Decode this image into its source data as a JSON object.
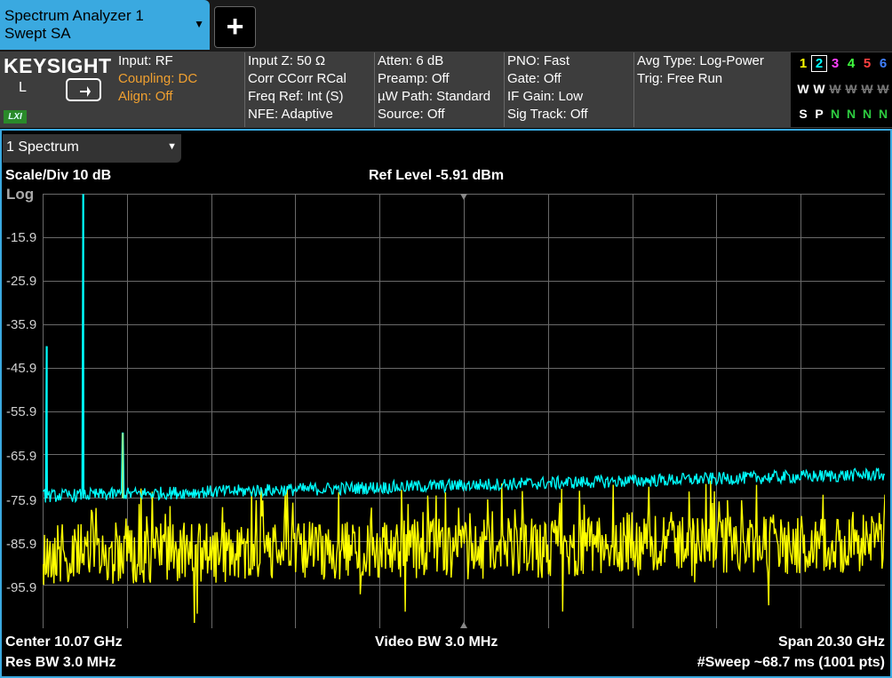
{
  "tab": {
    "title_line1": "Spectrum Analyzer 1",
    "title_line2": "Swept SA",
    "caret": "▼",
    "add_label": "+"
  },
  "brand": {
    "logo": "KEYSIGHT",
    "mode_letter": "L",
    "lxi": "LXI"
  },
  "settings": {
    "col1": [
      "Input: RF",
      "Coupling: DC",
      "Align: Off"
    ],
    "col2": [
      "Input Z: 50 Ω",
      "Corr CCorr RCal",
      "Freq Ref: Int (S)",
      "NFE: Adaptive"
    ],
    "col3": [
      "Atten: 6 dB",
      "Preamp: Off",
      "µW Path: Standard",
      "Source: Off"
    ],
    "col4": [
      "PNO: Fast",
      "Gate: Off",
      "IF Gain: Low",
      "Sig Track: Off"
    ],
    "col5": [
      "Avg Type: Log-Power",
      "Trig: Free Run"
    ]
  },
  "traces": {
    "numbers": [
      "1",
      "2",
      "3",
      "4",
      "5",
      "6"
    ],
    "number_colors": [
      "#ffff00",
      "#00ffff",
      "#ff40ff",
      "#40ff40",
      "#ff4040",
      "#4080ff"
    ],
    "modes": [
      "W",
      "W",
      "W",
      "W",
      "W",
      "W"
    ],
    "detectors": [
      "S",
      "P",
      "N",
      "N",
      "N",
      "N"
    ]
  },
  "window": {
    "label": "1 Spectrum",
    "caret": "▼"
  },
  "graph": {
    "scale": "Scale/Div 10 dB",
    "ref_level": "Ref Level -5.91 dBm",
    "log": "Log",
    "y_ticks": [
      "-15.9",
      "-25.9",
      "-35.9",
      "-45.9",
      "-55.9",
      "-65.9",
      "-75.9",
      "-85.9",
      "-95.9"
    ],
    "center": "Center 10.07 GHz",
    "res_bw": "Res BW 3.0 MHz",
    "video_bw": "Video BW 3.0 MHz",
    "span": "Span 20.30 GHz",
    "sweep": "#Sweep ~68.7 ms (1001 pts)"
  },
  "chart_data": {
    "type": "line",
    "ylim": [
      -105.91,
      -5.91
    ],
    "x_range_ghz": [
      -0.08,
      20.22
    ],
    "grid": true,
    "series": [
      {
        "color": "#ffff00",
        "floor_dbm": -82,
        "noise_span_db": 14,
        "spurs": []
      },
      {
        "color": "#00ffff",
        "floor_dbm": -77,
        "noise_span_db": 3,
        "slope_db": 5,
        "spurs": [
          {
            "x_ghz": 0.02,
            "dbm": -41
          },
          {
            "x_ghz": 0.9,
            "dbm": -6
          },
          {
            "x_ghz": 1.85,
            "dbm": -61
          }
        ]
      }
    ]
  },
  "colors": {
    "accent": "#3aa9e0",
    "trace1": "#ffff00",
    "trace2": "#00ffff",
    "grid": "#6a6a6a"
  }
}
